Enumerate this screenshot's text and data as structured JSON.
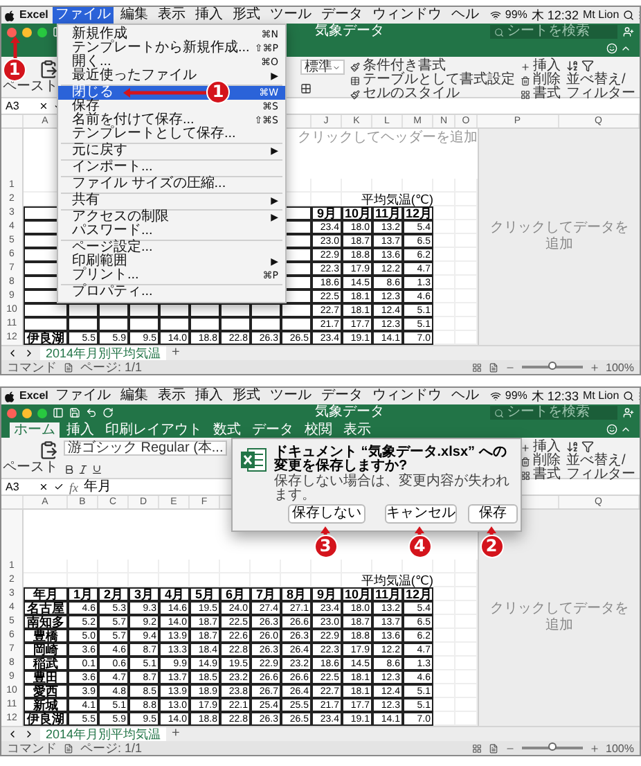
{
  "panels": [
    {
      "menubar": {
        "app": "Excel",
        "menus": [
          {
            "label": "ファイル",
            "selected": true
          },
          {
            "label": "編集",
            "selected": false
          },
          {
            "label": "表示",
            "selected": false
          },
          {
            "label": "挿入",
            "selected": false
          },
          {
            "label": "形式",
            "selected": false
          },
          {
            "label": "ツール",
            "selected": false
          },
          {
            "label": "データ",
            "selected": false
          },
          {
            "label": "ウィンドウ",
            "selected": false
          },
          {
            "label": "ヘル",
            "selected": false
          }
        ],
        "battery": "99%",
        "clock": "木 12:32",
        "user": "Mt Lion"
      },
      "title": "気象データ",
      "search_placeholder": "シートを検索",
      "ribbon": {
        "paste": "ペースト",
        "number_format": "標準",
        "styles": [
          "条件付き書式",
          "テーブルとして書式設定",
          "セルのスタイル"
        ],
        "cells": [
          "挿入",
          "削除",
          "書式"
        ],
        "sort": "並べ替え/フィルター"
      },
      "formula_bar": {
        "name_box": "A3"
      },
      "columns_left": [
        "A"
      ],
      "columns_right": [
        "J",
        "K",
        "L",
        "M",
        "N",
        "O",
        "P",
        "Q"
      ],
      "row_numbers": [
        "1",
        "2",
        "3",
        "4",
        "5",
        "6",
        "7",
        "8",
        "9",
        "10",
        "11",
        "12"
      ],
      "header_hint": "クリックしてヘッダーを追加",
      "data_hint": "クリックしてデータを追加",
      "table": {
        "caption": "平均気温(℃)",
        "header": [
          "9月",
          "10月",
          "11月",
          "12月"
        ],
        "rows": [
          [
            "23.4",
            "18.0",
            "13.2",
            "5.4"
          ],
          [
            "23.0",
            "18.7",
            "13.7",
            "6.5"
          ],
          [
            "22.9",
            "18.8",
            "13.6",
            "6.2"
          ],
          [
            "22.3",
            "17.9",
            "12.2",
            "4.7"
          ],
          [
            "18.6",
            "14.5",
            "8.6",
            "1.3"
          ],
          [
            "22.5",
            "18.1",
            "12.3",
            "4.6"
          ],
          [
            "22.7",
            "18.1",
            "12.4",
            "5.1"
          ],
          [
            "21.7",
            "17.7",
            "12.3",
            "5.1"
          ],
          [
            "伊良湖",
            "5.5",
            "5.9",
            "9.5",
            "14.0",
            "18.8",
            "22.8",
            "26.3",
            "26.5",
            "23.4",
            "19.1",
            "14.1",
            "7.0"
          ]
        ]
      },
      "sheet_tab": {
        "label": "2014年月別平均気温",
        "selected": true
      },
      "add_sheet": "+",
      "status": {
        "mode": "コマンド",
        "page": "ページ: 1/1",
        "zoom": "100%",
        "zoom_slider": {
          "level": 0.5
        }
      },
      "menu": [
        {
          "kind": "item",
          "label": "新規作成",
          "shortcut": "⌘N",
          "selected": false
        },
        {
          "kind": "item",
          "label": "テンプレートから新規作成...",
          "shortcut": "⇧⌘P",
          "selected": false
        },
        {
          "kind": "item",
          "label": "開く...",
          "shortcut": "⌘O",
          "selected": false
        },
        {
          "kind": "item",
          "label": "最近使ったファイル",
          "arrow": "▶",
          "selected": false
        },
        {
          "kind": "separator"
        },
        {
          "kind": "item",
          "label": "閉じる",
          "shortcut": "⌘W",
          "selected": true
        },
        {
          "kind": "item",
          "label": "保存",
          "shortcut": "⌘S",
          "selected": false
        },
        {
          "kind": "item",
          "label": "名前を付けて保存...",
          "shortcut": "⇧⌘S",
          "selected": false
        },
        {
          "kind": "item",
          "label": "テンプレートとして保存...",
          "selected": false
        },
        {
          "kind": "separator"
        },
        {
          "kind": "item",
          "label": "元に戻す",
          "arrow": "▶",
          "selected": false
        },
        {
          "kind": "separator"
        },
        {
          "kind": "item",
          "label": "インポート...",
          "selected": false
        },
        {
          "kind": "separator"
        },
        {
          "kind": "item",
          "label": "ファイル サイズの圧縮...",
          "selected": false
        },
        {
          "kind": "separator"
        },
        {
          "kind": "item",
          "label": "共有",
          "arrow": "▶",
          "selected": false
        },
        {
          "kind": "separator"
        },
        {
          "kind": "item",
          "label": "アクセスの制限",
          "arrow": "▶",
          "selected": false
        },
        {
          "kind": "item",
          "label": "パスワード...",
          "selected": false
        },
        {
          "kind": "separator"
        },
        {
          "kind": "item",
          "label": "ページ設定...",
          "selected": false
        },
        {
          "kind": "item",
          "label": "印刷範囲",
          "arrow": "▶",
          "selected": false
        },
        {
          "kind": "item",
          "label": "プリント...",
          "shortcut": "⌘P",
          "selected": false
        },
        {
          "kind": "separator"
        },
        {
          "kind": "item",
          "label": "プロパティ...",
          "selected": false
        }
      ],
      "callouts": [
        {
          "number": "1",
          "kind": "close"
        },
        {
          "number": "1",
          "kind": "menu-item"
        }
      ]
    },
    {
      "menubar": {
        "app": "Excel",
        "menus": [
          {
            "label": "ファイル",
            "selected": false
          },
          {
            "label": "編集",
            "selected": false
          },
          {
            "label": "表示",
            "selected": false
          },
          {
            "label": "挿入",
            "selected": false
          },
          {
            "label": "形式",
            "selected": false
          },
          {
            "label": "ツール",
            "selected": false
          },
          {
            "label": "データ",
            "selected": false
          },
          {
            "label": "ウィンドウ",
            "selected": false
          },
          {
            "label": "ヘル",
            "selected": false
          }
        ],
        "battery": "99%",
        "clock": "木 12:33",
        "user": "Mt Lion"
      },
      "title": "気象データ",
      "search_placeholder": "シートを検索",
      "ribbon_tabs": [
        {
          "label": "ホーム",
          "selected": true
        },
        {
          "label": "挿入",
          "selected": false
        },
        {
          "label": "印刷レイアウト",
          "selected": false
        },
        {
          "label": "数式",
          "selected": false
        },
        {
          "label": "データ",
          "selected": false
        },
        {
          "label": "校閲",
          "selected": false
        },
        {
          "label": "表示",
          "selected": false
        }
      ],
      "ribbon": {
        "paste": "ペースト",
        "font": "游ゴシック Regular (本...",
        "cells": [
          "挿入",
          "削除",
          "書式"
        ],
        "sort": "並べ替え/フィルター"
      },
      "formula_bar": {
        "name_box": "A3",
        "fx": "fx",
        "value": "年月"
      },
      "columns_left": [
        "A",
        "B",
        "C",
        "D",
        "E",
        "F"
      ],
      "columns_right": [
        "Q"
      ],
      "row_numbers": [
        "1",
        "2",
        "3",
        "4",
        "5",
        "6",
        "7",
        "8",
        "9",
        "10",
        "11",
        "12"
      ],
      "data_hint": "クリックしてデータを追加",
      "table": {
        "caption": "平均気温(℃)",
        "header": [
          "年月",
          "1月",
          "2月",
          "3月",
          "4月",
          "5月",
          "6月",
          "7月",
          "8月",
          "9月",
          "10月",
          "11月",
          "12月"
        ],
        "rows": [
          [
            "名古屋",
            "4.6",
            "5.3",
            "9.3",
            "14.6",
            "19.5",
            "24.0",
            "27.4",
            "27.1",
            "23.4",
            "18.0",
            "13.2",
            "5.4"
          ],
          [
            "南知多",
            "5.2",
            "5.7",
            "9.2",
            "14.0",
            "18.7",
            "22.5",
            "26.3",
            "26.6",
            "23.0",
            "18.7",
            "13.7",
            "6.5"
          ],
          [
            "豊橋",
            "5.0",
            "5.7",
            "9.4",
            "13.9",
            "18.7",
            "22.6",
            "26.0",
            "26.3",
            "22.9",
            "18.8",
            "13.6",
            "6.2"
          ],
          [
            "岡崎",
            "3.6",
            "4.6",
            "8.7",
            "13.3",
            "18.4",
            "22.8",
            "26.3",
            "26.4",
            "22.3",
            "17.9",
            "12.2",
            "4.7"
          ],
          [
            "稲武",
            "0.1",
            "0.6",
            "5.1",
            "9.9",
            "14.9",
            "19.5",
            "22.9",
            "23.2",
            "18.6",
            "14.5",
            "8.6",
            "1.3"
          ],
          [
            "豊田",
            "3.6",
            "4.7",
            "8.7",
            "13.7",
            "18.5",
            "23.2",
            "26.6",
            "26.6",
            "22.5",
            "18.1",
            "12.3",
            "4.6"
          ],
          [
            "愛西",
            "3.9",
            "4.8",
            "8.5",
            "13.9",
            "18.9",
            "23.8",
            "26.7",
            "26.4",
            "22.7",
            "18.1",
            "12.4",
            "5.1"
          ],
          [
            "新城",
            "4.1",
            "5.1",
            "8.8",
            "13.0",
            "17.9",
            "22.1",
            "25.4",
            "25.5",
            "21.7",
            "17.7",
            "12.3",
            "5.1"
          ],
          [
            "伊良湖",
            "5.5",
            "5.9",
            "9.5",
            "14.0",
            "18.8",
            "22.8",
            "26.3",
            "26.5",
            "23.4",
            "19.1",
            "14.1",
            "7.0"
          ]
        ]
      },
      "sheet_tab": {
        "label": "2014年月別平均気温",
        "selected": true
      },
      "add_sheet": "+",
      "status": {
        "mode": "コマンド",
        "page": "ページ: 1/1",
        "zoom": "100%",
        "zoom_slider": {
          "level": 0.5
        }
      },
      "dialog": {
        "title": "ドキュメント “気象データ.xlsx” への変更を保存しますか?",
        "message": "保存しない場合は、変更内容が失われます。",
        "buttons": [
          {
            "label": "保存しない",
            "kind": "dont-save"
          },
          {
            "label": "キャンセル",
            "kind": "cancel"
          },
          {
            "label": "保存",
            "kind": "save"
          }
        ]
      },
      "callouts": [
        {
          "number": "3",
          "kind": "dont-save"
        },
        {
          "number": "4",
          "kind": "cancel"
        },
        {
          "number": "2",
          "kind": "save"
        }
      ]
    }
  ]
}
